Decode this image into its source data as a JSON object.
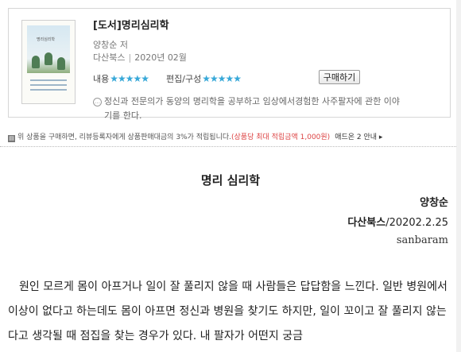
{
  "book": {
    "title": "[도서]명리심리학",
    "author": "양창순 저",
    "publisher": "다산북스",
    "date": "2020년 02월",
    "rating_content_label": "내용",
    "rating_content_stars": "★★★★★",
    "rating_edit_label": "편집/구성",
    "rating_edit_stars": "★★★★★",
    "buy_label": "구매하기",
    "description_line1": "정신과 전문의가 동양의 명리학을 공부하고 임상에서경험한 사주팔자에 관한 이야",
    "description_line2": "기를 한다.",
    "cover_title": "명리심리학"
  },
  "notice": {
    "text": "위 상품을 구매하면, 리뷰등록자에게 상품판매대금의 3%가 적립됩니다.",
    "highlight": "(상품당 최대 적립금액 1,000원)",
    "link": "애드온 2 안내 ▸"
  },
  "review": {
    "title": "명리 심리학",
    "author": "양창순",
    "publisher": "다산북스",
    "pub_date": "/20202.2.25",
    "signature": "sanbaram",
    "body": "원인 모르게 몸이 아프거나 일이 잘 풀리지 않을 때 사람들은 답답함을 느낀다. 일반 병원에서 이상이 없다고 하는데도 몸이 아프면 정신과 병원을 찾기도 하지만, 일이 꼬이고 잘 풀리지 않는다고 생각될 때 점집을 찾는 경우가 있다. 내 팔자가 어떤지 궁금"
  }
}
